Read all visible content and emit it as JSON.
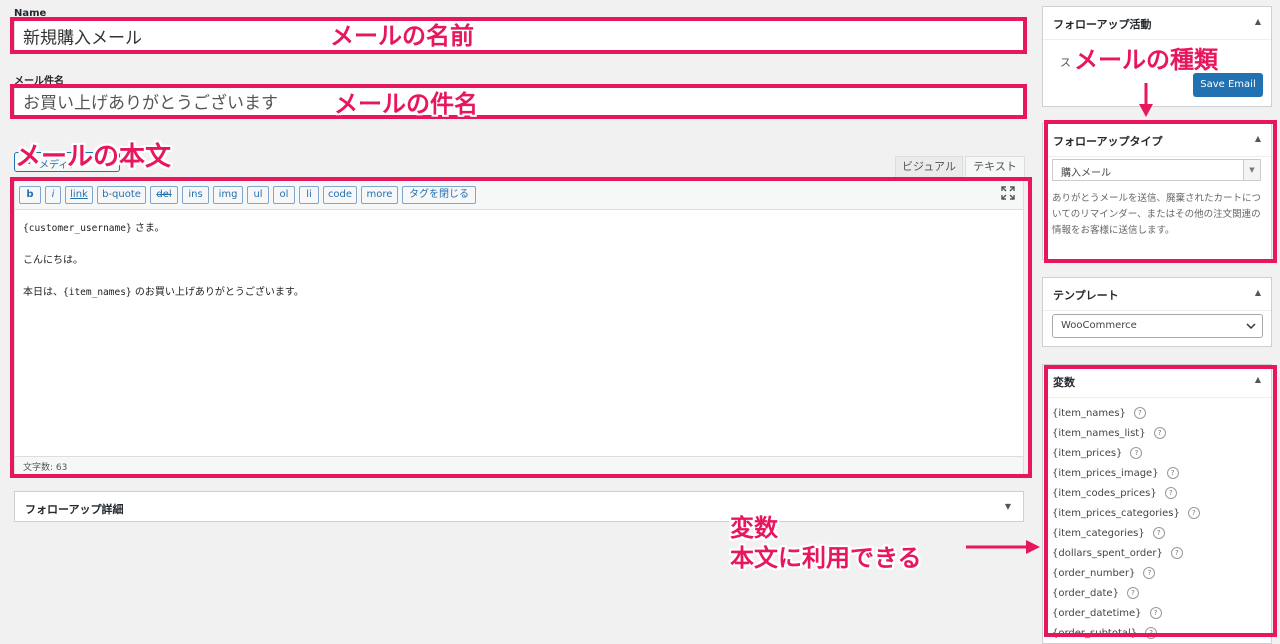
{
  "form": {
    "name_label": "Name",
    "name_value": "新規購入メール",
    "subject_label": "メール件名",
    "subject_value": "お買い上げありがとうございます"
  },
  "editor": {
    "media_button": "メディア",
    "tab_visual": "ビジュアル",
    "tab_text": "テキスト",
    "quicktags": [
      "b",
      "i",
      "link",
      "b-quote",
      "del",
      "ins",
      "img",
      "ul",
      "ol",
      "li",
      "code",
      "more",
      "タグを閉じる"
    ],
    "line1_var": "{customer_username}",
    "line1_rest": " さま。",
    "line2": "こんにちは。",
    "line3_pre": "本日は、",
    "line3_var": "{item_names}",
    "line3_rest": " のお買い上げありがとうございます。",
    "word_count": "文字数: 63"
  },
  "details_panel": {
    "title": "フォローアップ詳細"
  },
  "sidebar": {
    "activity": {
      "title": "フォローアップ活動",
      "status_partial": "ス",
      "save_button": "Save Email"
    },
    "type": {
      "title": "フォローアップタイプ",
      "selected": "購入メール",
      "description": "ありがとうメールを送信、廃棄されたカートについてのリマインダー、またはその他の注文関連の情報をお客様に送信します。"
    },
    "template": {
      "title": "テンプレート",
      "selected": "WooCommerce"
    },
    "variables": {
      "title": "変数",
      "items": [
        "{item_names}",
        "{item_names_list}",
        "{item_prices}",
        "{item_prices_image}",
        "{item_codes_prices}",
        "{item_prices_categories}",
        "{item_categories}",
        "{dollars_spent_order}",
        "{order_number}",
        "{order_date}",
        "{order_datetime}",
        "{order_subtotal}"
      ]
    }
  },
  "annotations": {
    "name": "メールの名前",
    "subject": "メールの件名",
    "body": "メールの本文",
    "type": "メールの種類",
    "vars_line1": "変数",
    "vars_line2": "本文に利用できる"
  },
  "colors": {
    "highlight": "#e8175d",
    "primary_button": "#2271b1"
  }
}
